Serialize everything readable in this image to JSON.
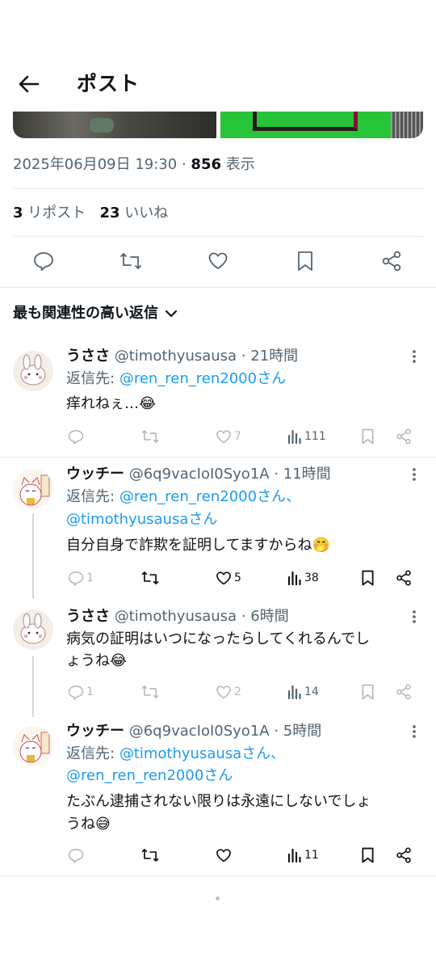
{
  "header": {
    "title": "ポスト"
  },
  "post": {
    "timestamp": "2025年06月09日 19:30",
    "separator": "·",
    "views_count": "856",
    "views_label": "表示",
    "reposts_count": "3",
    "reposts_label": "リポスト",
    "likes_count": "23",
    "likes_label": "いいね"
  },
  "sort": {
    "label": "最も関連性の高い返信"
  },
  "replies": [
    {
      "name": "うささ",
      "handle": "@timothyusausa",
      "time": "· 21時間",
      "reply_to_label": "返信先:",
      "reply_to_1": "@ren_ren_ren2000さん",
      "reply_to_2": "",
      "text_1": "痒れねぇ…😂",
      "text_2": "",
      "replies_count": "",
      "reposts_count": "",
      "likes_count": "7",
      "views_count": "111"
    },
    {
      "name": "ウッチー",
      "handle": "@6q9vacIoI0Syo1A",
      "time": "· 11時間",
      "reply_to_label": "返信先:",
      "reply_to_1": "@ren_ren_ren2000さん、",
      "reply_to_2": "@timothyusausaさん",
      "text_1": "自分自身で詐欺を証明してますからね🤭",
      "text_2": "",
      "replies_count": "1",
      "reposts_count": "",
      "likes_count": "5",
      "views_count": "38"
    },
    {
      "name": "うささ",
      "handle": "@timothyusausa",
      "time": "· 6時間",
      "reply_to_label": "",
      "reply_to_1": "",
      "reply_to_2": "",
      "text_1": "病気の証明はいつになったらしてくれるんでし",
      "text_2": "ょうね😂",
      "replies_count": "1",
      "reposts_count": "",
      "likes_count": "2",
      "views_count": "14"
    },
    {
      "name": "ウッチー",
      "handle": "@6q9vacIoI0Syo1A",
      "time": "· 5時間",
      "reply_to_label": "返信先:",
      "reply_to_1": "@timothyusausaさん、",
      "reply_to_2": "@ren_ren_ren2000さん",
      "text_1": "たぶん逮捕されない限りは永遠にしないでしょ",
      "text_2": "うね😅",
      "replies_count": "",
      "reposts_count": "",
      "likes_count": "",
      "views_count": "11"
    }
  ],
  "colors": {
    "accent": "#1d9bf0",
    "secondary_text": "#536471",
    "primary_text": "#0f1419",
    "divider": "#e6e9ec"
  }
}
